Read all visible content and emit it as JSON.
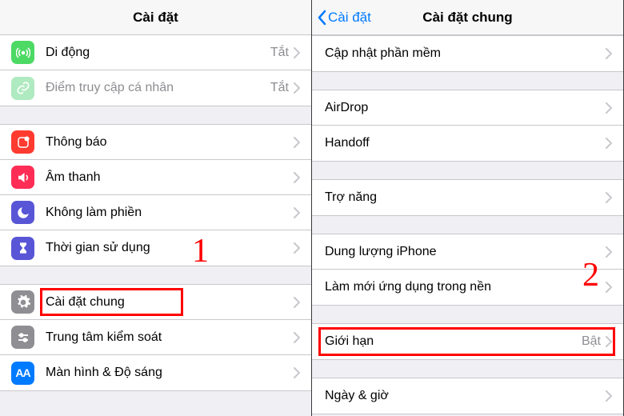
{
  "left": {
    "title": "Cài đặt",
    "groups": [
      [
        {
          "icon": "cellular",
          "label": "Di động",
          "value": "Tắt",
          "chevron": true
        },
        {
          "icon": "hotspot",
          "label": "Điểm truy cập cá nhân",
          "value": "Tắt",
          "chevron": true,
          "disabled": true
        }
      ],
      [
        {
          "icon": "notifications",
          "label": "Thông báo",
          "chevron": true
        },
        {
          "icon": "sounds",
          "label": "Âm thanh",
          "chevron": true
        },
        {
          "icon": "dnd",
          "label": "Không làm phiền",
          "chevron": true
        },
        {
          "icon": "screentime",
          "label": "Thời gian sử dụng",
          "chevron": true
        }
      ],
      [
        {
          "icon": "general",
          "label": "Cài đặt chung",
          "chevron": true,
          "hl": true
        },
        {
          "icon": "control",
          "label": "Trung tâm kiểm soát",
          "chevron": true
        },
        {
          "icon": "display",
          "label": "Màn hình & Độ sáng",
          "chevron": true
        }
      ]
    ],
    "annotation": "1"
  },
  "right": {
    "back": "Cài đặt",
    "title": "Cài đặt chung",
    "groups": [
      [
        {
          "label": "Cập nhật phần mềm",
          "chevron": true
        }
      ],
      [
        {
          "label": "AirDrop",
          "chevron": true
        },
        {
          "label": "Handoff",
          "chevron": true
        }
      ],
      [
        {
          "label": "Trợ năng",
          "chevron": true
        }
      ],
      [
        {
          "label": "Dung lượng iPhone",
          "chevron": true
        },
        {
          "label": "Làm mới ứng dụng trong nền",
          "chevron": true
        }
      ],
      [
        {
          "label": "Giới hạn",
          "value": "Bật",
          "chevron": true,
          "hl": true
        }
      ],
      [
        {
          "label": "Ngày & giờ",
          "chevron": true
        }
      ]
    ],
    "annotation": "2"
  },
  "icons": {
    "cellular": {
      "bg": "#4cd964",
      "glyph": "antenna"
    },
    "hotspot": {
      "bg": "#b0eac0",
      "glyph": "link"
    },
    "notifications": {
      "bg": "#ff3b30",
      "glyph": "notif"
    },
    "sounds": {
      "bg": "#ff2d55",
      "glyph": "speaker"
    },
    "dnd": {
      "bg": "#5856d6",
      "glyph": "moon"
    },
    "screentime": {
      "bg": "#5856d6",
      "glyph": "hourglass"
    },
    "general": {
      "bg": "#8e8e93",
      "glyph": "gear"
    },
    "control": {
      "bg": "#8e8e93",
      "glyph": "sliders"
    },
    "display": {
      "bg": "#007aff",
      "glyph": "aa"
    }
  }
}
